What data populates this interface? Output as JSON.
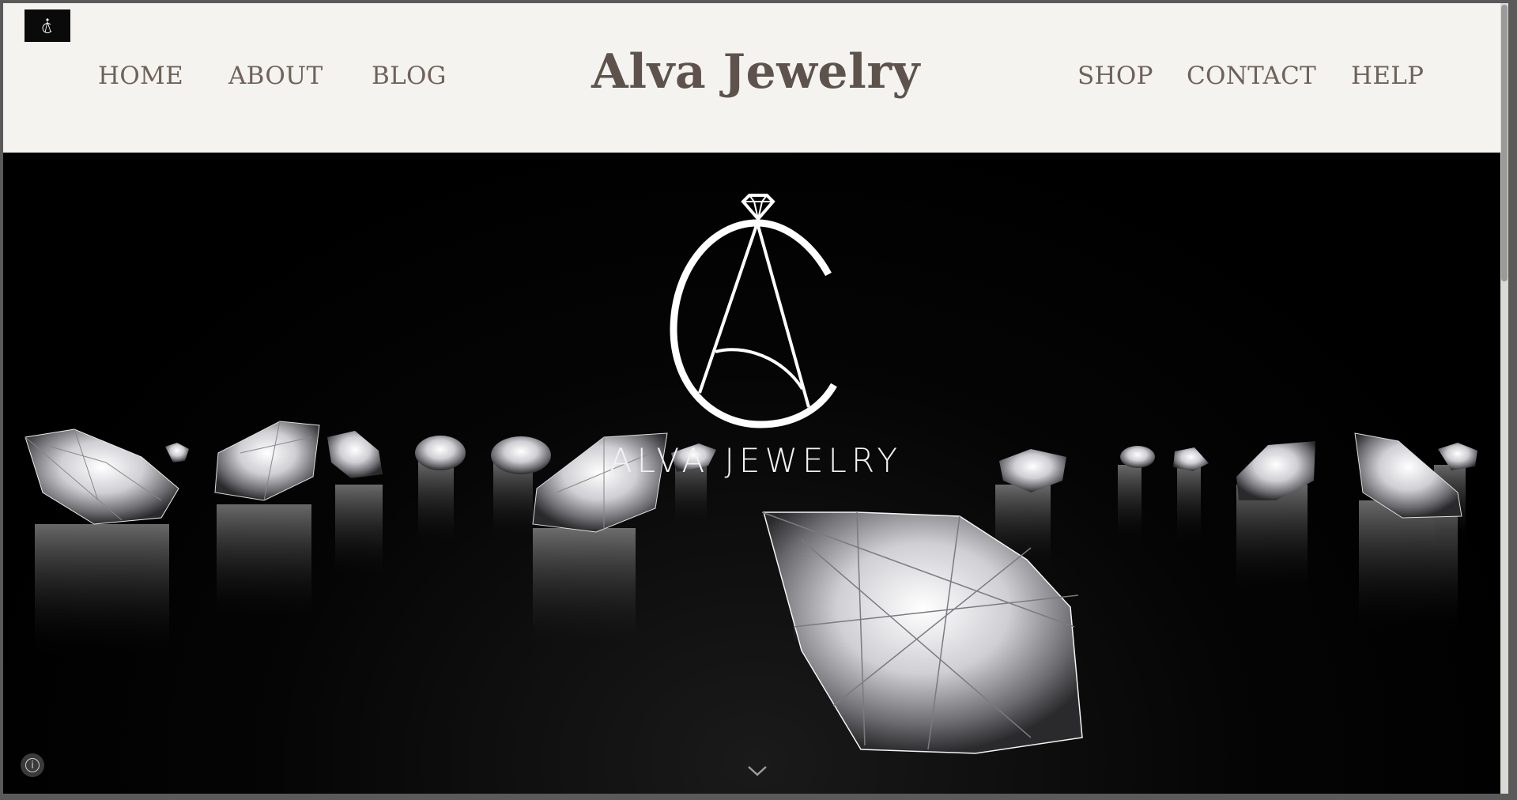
{
  "site": {
    "title": "Alva Jewelry",
    "wordmark": "ALVA JEWELRY",
    "monogram_letters": "CA"
  },
  "nav_left": [
    {
      "label": "HOME"
    },
    {
      "label": "ABOUT"
    },
    {
      "label": "BLOG"
    }
  ],
  "nav_right": [
    {
      "label": "SHOP"
    },
    {
      "label": "CONTACT"
    },
    {
      "label": "HELP"
    }
  ],
  "icons": {
    "scroll": "chevron-down-icon",
    "info": "info-icon",
    "logo": "diamond-ring-icon"
  },
  "info_symbol": "i",
  "colors": {
    "header_bg": "#f4f3ef",
    "nav_text": "#6e625a",
    "brand_text": "#5e534c",
    "hero_bg": "#000000",
    "hero_text": "#f2f2f2"
  }
}
